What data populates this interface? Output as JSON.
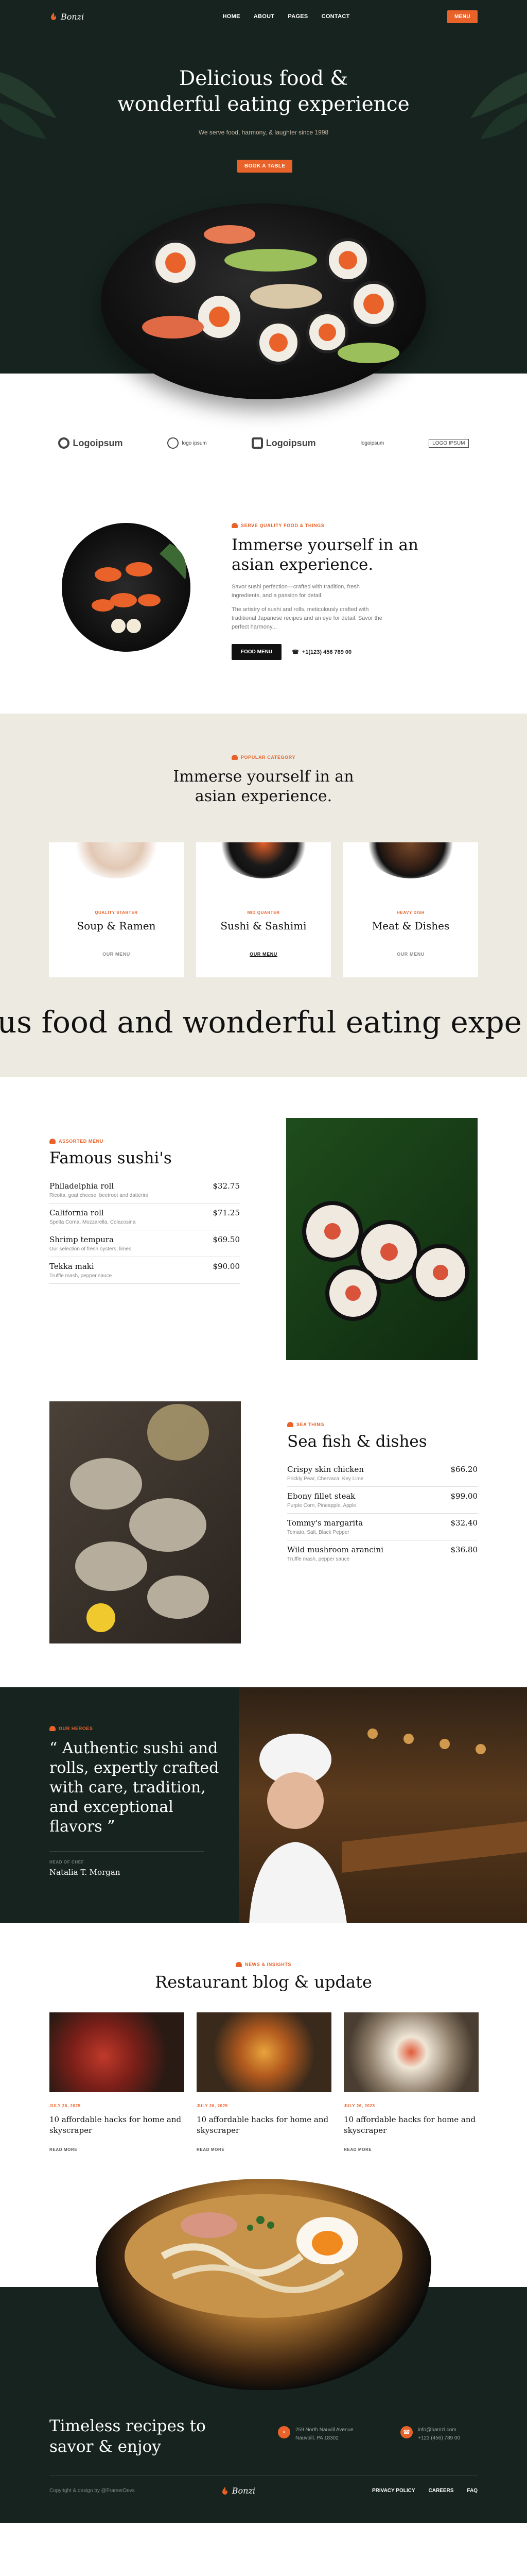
{
  "brand": {
    "name": "Bonzi"
  },
  "nav": {
    "items": [
      "HOME",
      "ABOUT",
      "PAGES",
      "CONTACT"
    ],
    "cta": "MENU"
  },
  "hero": {
    "title_line1": "Delicious food &",
    "title_line2": "wonderful eating experience",
    "subtitle": "We serve food, harmony, & laughter since 1998",
    "button": "BOOK A TABLE"
  },
  "logos": [
    "Logoipsum",
    "logo ipsum",
    "Logoipsum",
    "logoipsum",
    "LOGO IPSUM"
  ],
  "immerse": {
    "kicker": "SERVE QUALITY FOOD & THINGS",
    "title_line1": "Immerse yourself in an",
    "title_line2": "asian experience.",
    "para1": "Savor sushi perfection—crafted with tradition, fresh ingredients, and a passion for detail.",
    "para2": "The artistry of sushi and rolls, meticulously crafted with traditional Japanese recipes and an eye for detail. Savor the perfect harmony...",
    "button": "FOOD MENU",
    "phone": "+1(123) 456 789 00"
  },
  "category": {
    "kicker": "POPULAR CATEGORY",
    "title_line1": "Immerse yourself in an",
    "title_line2": "asian experience.",
    "cards": [
      {
        "kicker": "QUALITY STARTER",
        "title": "Soup & Ramen",
        "link": "OUR MENU"
      },
      {
        "kicker": "MID QUARTER",
        "title": "Sushi & Sashimi",
        "link": "OUR MENU"
      },
      {
        "kicker": "HEAVY DISH",
        "title": "Meat & Dishes",
        "link": "OUR MENU"
      }
    ],
    "marquee": "ous food and wonderful eating expe"
  },
  "sushi_menu": {
    "kicker": "ASSORTED MENU",
    "title": "Famous sushi's",
    "items": [
      {
        "name": "Philadelphia roll",
        "price": "$32.75",
        "desc": "Ricotta, goat cheese, beetroot and datterini"
      },
      {
        "name": "California roll",
        "price": "$71.25",
        "desc": "Spelta Corna, Mozzarella, Colacosina"
      },
      {
        "name": "Shrimp tempura",
        "price": "$69.50",
        "desc": "Our selection of fresh oysters, limes"
      },
      {
        "name": "Tekka maki",
        "price": "$90.00",
        "desc": "Truffle mash, pepper sauce"
      }
    ]
  },
  "fish_menu": {
    "kicker": "SEA THING",
    "title": "Sea fish & dishes",
    "items": [
      {
        "name": "Crispy skin chicken",
        "price": "$66.20",
        "desc": "Prickly Pear, Chervaca, Key Lime"
      },
      {
        "name": "Ebony fillet steak",
        "price": "$99.00",
        "desc": "Purple Corn, Pineapple, Apple"
      },
      {
        "name": "Tommy's margarita",
        "price": "$32.40",
        "desc": "Tomato, Salt, Black Pepper"
      },
      {
        "name": "Wild mushroom arancini",
        "price": "$36.80",
        "desc": "Truffle mash, pepper sauce"
      }
    ]
  },
  "testimonial": {
    "kicker": "OUR HEROES",
    "quote": "“ Authentic sushi and rolls, expertly crafted with care, tradition, and exceptional flavors ”",
    "role": "HEAD OF CHEF",
    "name": "Natalia T. Morgan"
  },
  "blog": {
    "kicker": "NEWS & INSIGHTS",
    "title": "Restaurant blog & update",
    "posts": [
      {
        "date": "JULY 26, 2025",
        "title": "10 affordable hacks for home and skyscraper",
        "more": "READ MORE"
      },
      {
        "date": "JULY 26, 2025",
        "title": "10 affordable hacks for home and skyscraper",
        "more": "READ MORE"
      },
      {
        "date": "JULY 26, 2025",
        "title": "10 affordable hacks for home and skyscraper",
        "more": "READ MORE"
      }
    ]
  },
  "footer": {
    "title": "Timeless recipes to savor & enjoy",
    "address1": "259 North Nauvill Avenue",
    "address2": "Nauvoill, PA 18302",
    "email": "info@bamzi.com",
    "phone": "+123 (456) 789 00",
    "copyright": "Copyright & design by @FramerDevs",
    "links": [
      "PRIVACY POLICY",
      "CAREERS",
      "FAQ"
    ]
  },
  "colors": {
    "accent": "#e8622a",
    "dark": "#16231f",
    "beige": "#eceae1"
  }
}
